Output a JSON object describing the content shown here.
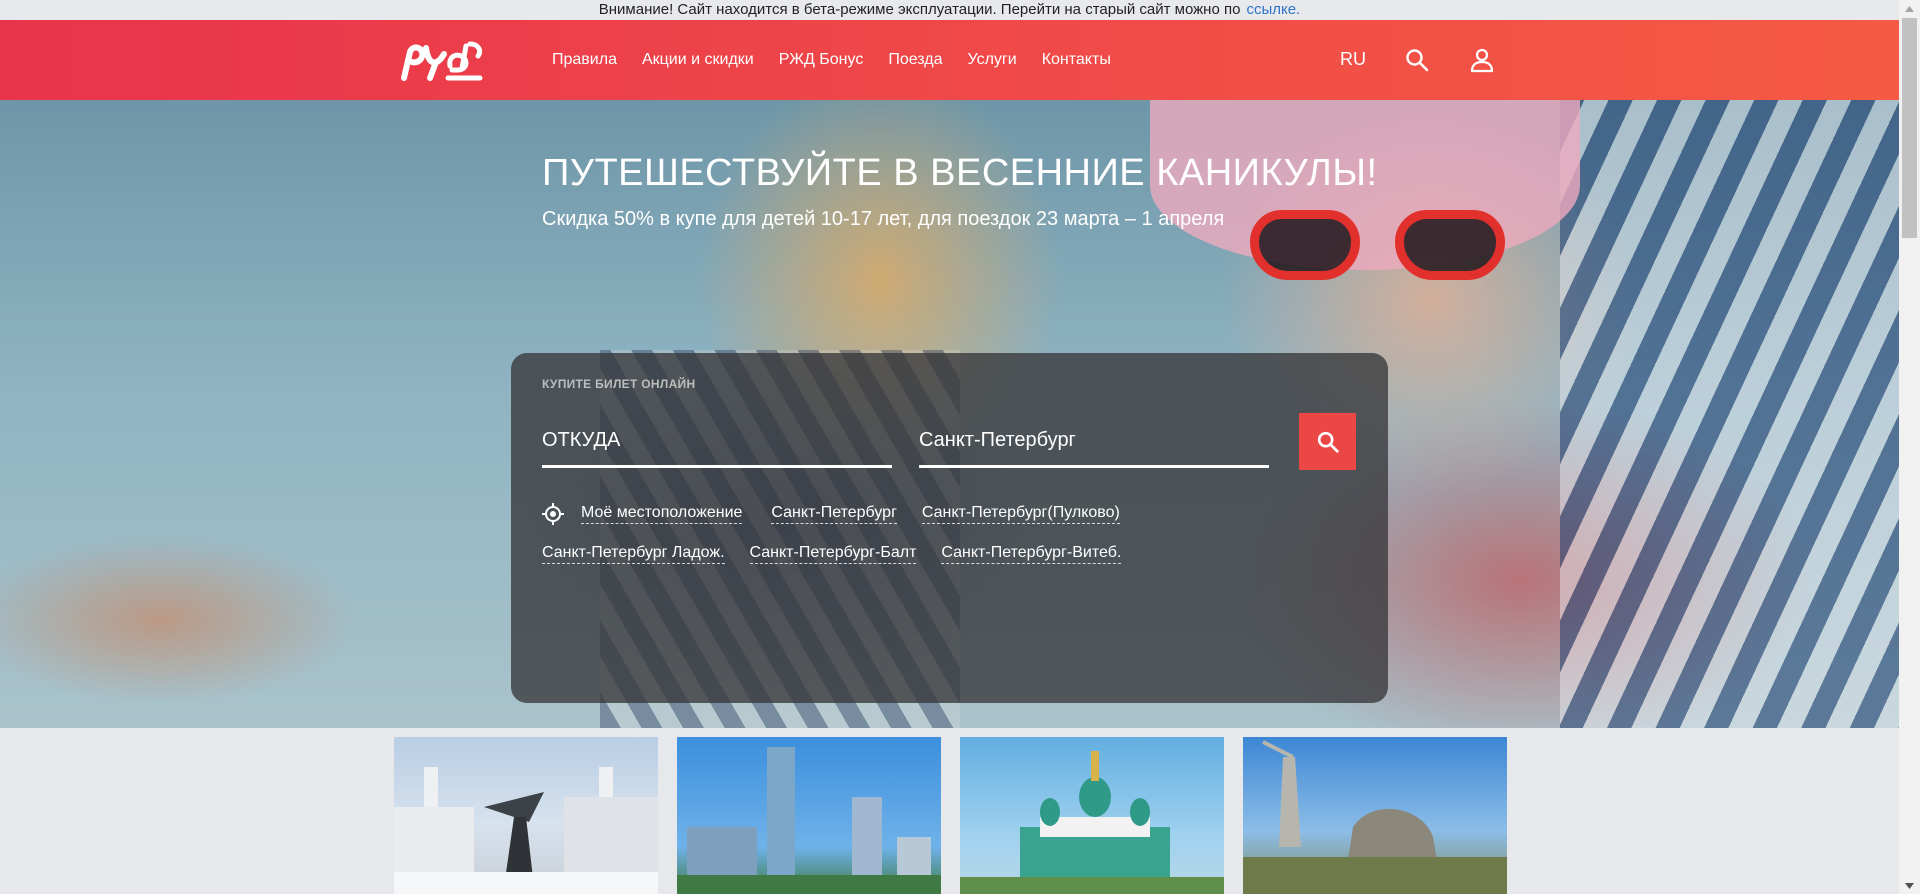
{
  "notice": {
    "text": "Внимание! Сайт находится в бета-режиме эксплуатации. Перейти на старый сайт можно по",
    "link": "ссылке."
  },
  "header": {
    "logo_text": "РЖД",
    "nav": [
      "Правила",
      "Акции и скидки",
      "РЖД Бонус",
      "Поезда",
      "Услуги",
      "Контакты"
    ],
    "lang": "RU",
    "search_icon": "search-icon",
    "user_icon": "user-icon"
  },
  "hero": {
    "title": "ПУТЕШЕСТВУЙТЕ В ВЕСЕННИЕ КАНИКУЛЫ!",
    "subtitle": "Скидка 50% в купе для детей 10-17 лет, для поездок 23 марта – 1 апреля"
  },
  "booking": {
    "caption": "КУПИТЕ БИЛЕТ ОНЛАЙН",
    "from_placeholder": "ОТКУДА",
    "to_value": "Санкт-Петербург",
    "my_location": "Моё местоположение",
    "suggestions_row1": [
      "Санкт-Петербург",
      "Санкт-Петербург(Пулково)"
    ],
    "suggestions_row2": [
      "Санкт-Петербург Ладож.",
      "Санкт-Петербург-Балт",
      "Санкт-Петербург-Витеб."
    ]
  },
  "colors": {
    "brand_red": "#ea4745",
    "header_gradient_start": "#e9334c",
    "header_gradient_end": "#f45a44",
    "link_blue": "#2f73c6"
  }
}
